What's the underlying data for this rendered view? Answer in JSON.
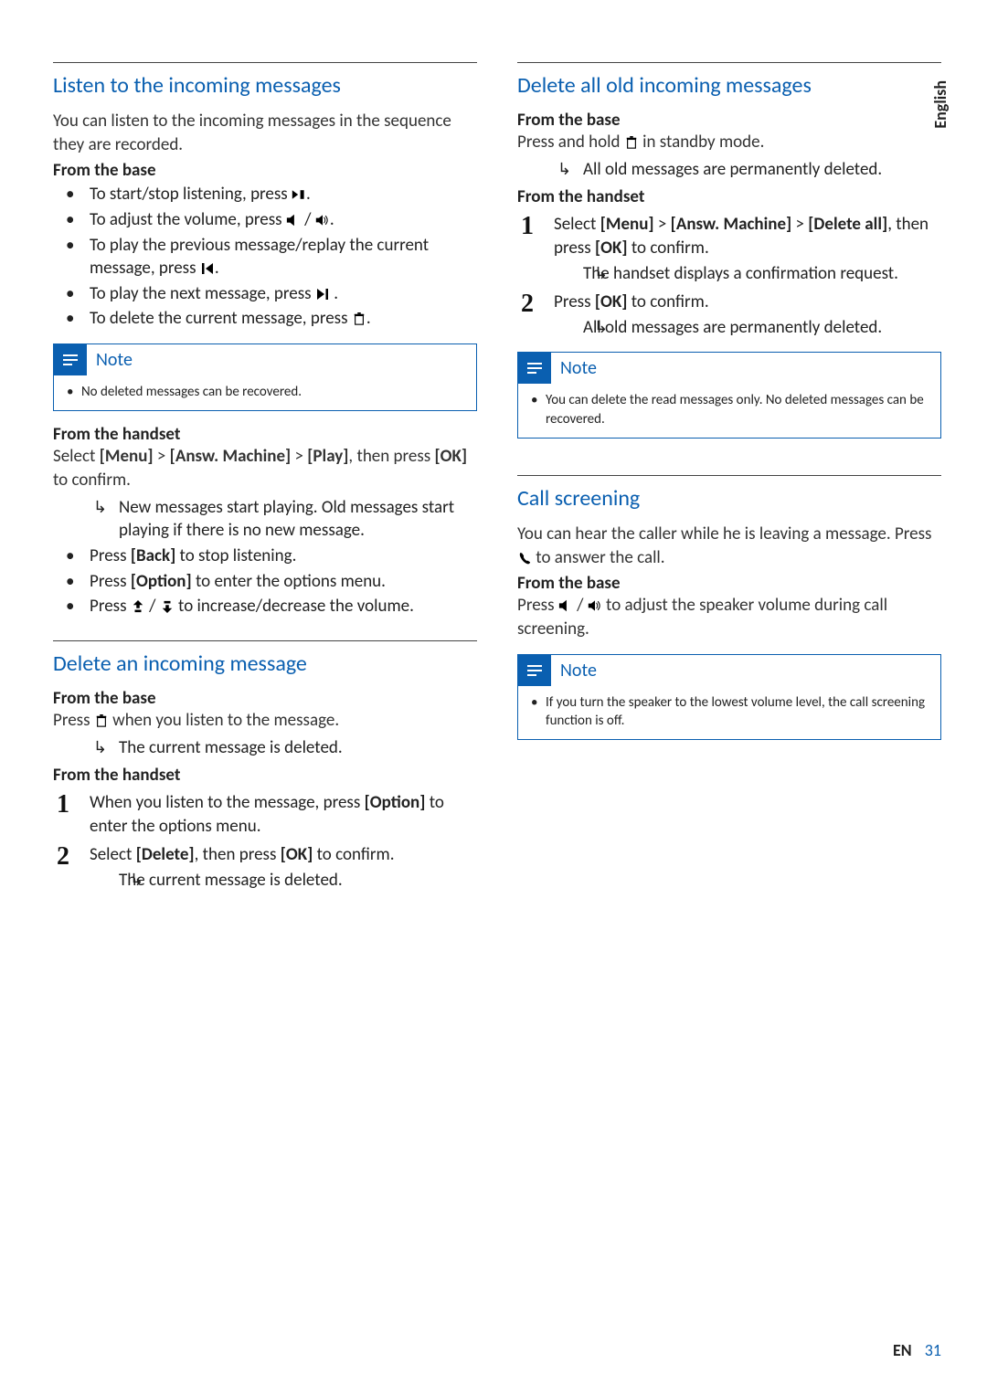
{
  "sideTab": "English",
  "footer": {
    "lang": "EN",
    "page": "31"
  },
  "col1": {
    "sec1": {
      "title": "Listen to the incoming messages",
      "intro": "You can listen to the incoming messages in the sequence they are recorded.",
      "fromBase": "From the base",
      "b1a": "To start/stop listening, press ",
      "b2a": "To adjust the volume, press ",
      "b2b": " / ",
      "b3a": "To play the previous message/replay the current message, press ",
      "b4a": "To play the next message, press ",
      "b5a": "To delete the current message, press ",
      "noteTitle": "Note",
      "note1": "No deleted messages can be recovered.",
      "fromHandset": "From the handset",
      "hs_a": "Select ",
      "hs_menu": "[Menu]",
      "hs_b": " > ",
      "hs_answ": "[Answ. Machine]",
      "hs_c": " > ",
      "hs_play": "[Play]",
      "hs_d": ", then press ",
      "hs_ok": "[OK]",
      "hs_e": " to confirm.",
      "hs_r1": "New messages start playing. Old messages start playing if there is no new message.",
      "hb1a": "Press ",
      "hb1_back": "[Back]",
      "hb1b": " to stop listening.",
      "hb2a": "Press ",
      "hb2_opt": "[Option]",
      "hb2b": " to enter the options menu.",
      "hb3a": "Press ",
      "hb3b": " / ",
      "hb3c": " to increase/decrease the volume."
    },
    "sec2": {
      "title": "Delete an incoming message",
      "fromBase": "From the base",
      "base_a": "Press ",
      "base_b": " when you listen to the message.",
      "base_r": "The current message is deleted.",
      "fromHandset": "From the handset",
      "s1a": "When you listen to the message, press ",
      "s1_opt": "[Option]",
      "s1b": " to enter the options menu.",
      "s2a": "Select ",
      "s2_del": "[Delete]",
      "s2b": ", then press ",
      "s2_ok": "[OK]",
      "s2c": " to confirm.",
      "s2_r": "The current message is deleted."
    }
  },
  "col2": {
    "sec1": {
      "title": "Delete all old incoming messages",
      "fromBase": "From the base",
      "base_a": "Press and hold ",
      "base_b": " in standby mode.",
      "base_r": "All old messages are permanently deleted.",
      "fromHandset": "From the handset",
      "s1a": "Select ",
      "s1_menu": "[Menu]",
      "s1b": " > ",
      "s1_answ": "[Answ. Machine]",
      "s1c": " > ",
      "s1_delall": "[Delete all]",
      "s1d": ", then press ",
      "s1_ok": "[OK]",
      "s1e": " to confirm.",
      "s1_r": "The handset displays a confirmation request.",
      "s2a": "Press ",
      "s2_ok": "[OK]",
      "s2b": " to confirm.",
      "s2_r": "All old messages are permanently deleted.",
      "noteTitle": "Note",
      "note1": "You can delete the read messages only. No deleted messages can be recovered."
    },
    "sec2": {
      "title": "Call screening",
      "intro_a": "You can hear the caller while he is leaving a message. Press ",
      "intro_b": " to answer the call.",
      "fromBase": "From the base",
      "b_a": "Press ",
      "b_b": " / ",
      "b_c": " to adjust the speaker volume during call screening.",
      "noteTitle": "Note",
      "note1": "If you turn the speaker to the lowest volume level, the call screening function is off."
    }
  }
}
